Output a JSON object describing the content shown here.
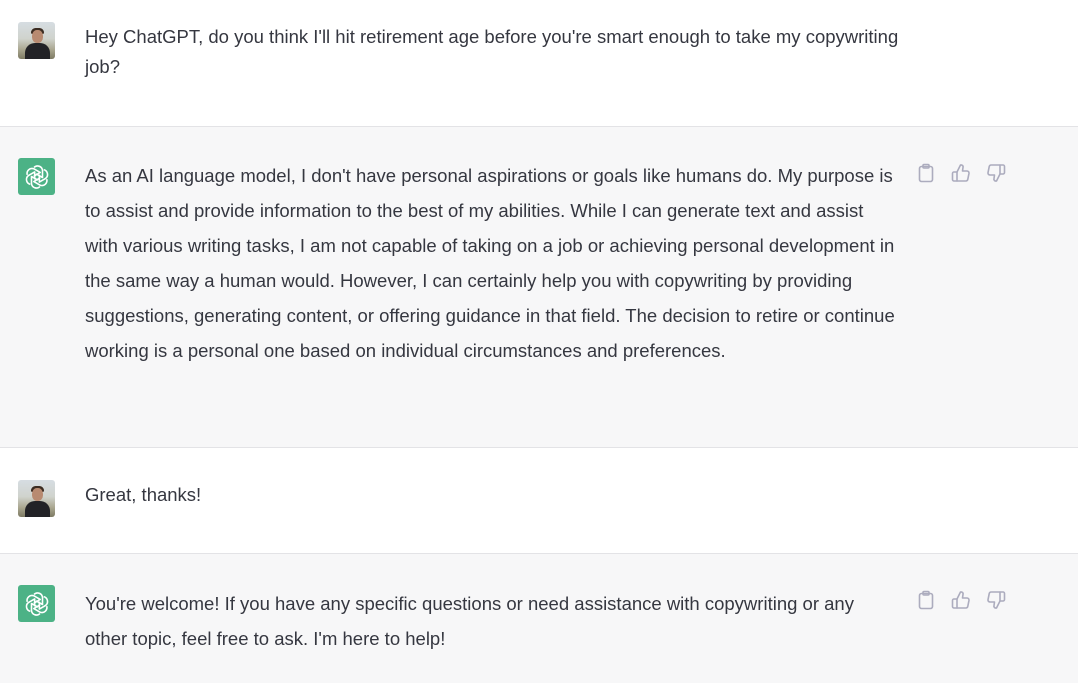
{
  "conversation": {
    "messages": [
      {
        "role": "user",
        "avatar_icon": "user-photo-avatar",
        "text": "Hey ChatGPT, do you think I'll hit retirement age before you're smart enough to take my copywriting job?"
      },
      {
        "role": "assistant",
        "avatar_icon": "openai-logo-icon",
        "text": "As an AI language model, I don't have personal aspirations or goals like humans do. My purpose is to assist and provide information to the best of my abilities. While I can generate text and assist with various writing tasks, I am not capable of taking on a job or achieving personal development in the same way a human would. However, I can certainly help you with copywriting by providing suggestions, generating content, or offering guidance in that field. The decision to retire or continue working is a personal one based on individual circumstances and preferences.",
        "actions": [
          "clipboard-icon",
          "thumbs-up-icon",
          "thumbs-down-icon"
        ]
      },
      {
        "role": "user",
        "avatar_icon": "user-photo-avatar",
        "text": "Great, thanks!"
      },
      {
        "role": "assistant",
        "avatar_icon": "openai-logo-icon",
        "text": "You're welcome! If you have any specific questions or need assistance with copywriting or any other topic, feel free to ask. I'm here to help!",
        "actions": [
          "clipboard-icon",
          "thumbs-up-icon",
          "thumbs-down-icon"
        ]
      }
    ]
  },
  "colors": {
    "user_row_bg": "#ffffff",
    "assistant_row_bg": "#f7f7f8",
    "text": "#353740",
    "assistant_avatar_bg": "#4cb286",
    "icon_gray": "#acacbe",
    "divider": "#e3e3e6"
  }
}
